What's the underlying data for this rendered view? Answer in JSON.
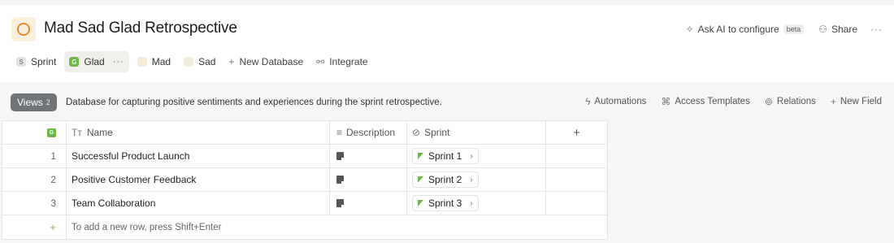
{
  "header": {
    "title": "Mad Sad Glad Retrospective",
    "ask_ai_label": "Ask AI to configure",
    "beta_label": "beta",
    "share_label": "Share",
    "more_label": "···"
  },
  "tabs": [
    {
      "label": "Sprint",
      "badge": "S"
    },
    {
      "label": "Glad",
      "badge": "G",
      "more": "···"
    },
    {
      "label": "Mad",
      "badge": ""
    },
    {
      "label": "Sad",
      "badge": ""
    },
    {
      "label": "New Database",
      "icon": "+"
    },
    {
      "label": "Integrate",
      "icon": "link-icon"
    }
  ],
  "toolbar": {
    "views_label": "Views",
    "views_count": "2",
    "description": "Database for capturing positive sentiments and experiences during the sprint retrospective.",
    "automations_label": "Automations",
    "access_templates_label": "Access Templates",
    "relations_label": "Relations",
    "new_field_label": "New Field"
  },
  "table": {
    "index_badge": "G",
    "columns": {
      "name": "Name",
      "description": "Description",
      "sprint": "Sprint",
      "add": "+"
    },
    "rows": [
      {
        "index": "1",
        "name": "Successful Product Launch",
        "sprint": "Sprint 1"
      },
      {
        "index": "2",
        "name": "Positive Customer Feedback",
        "sprint": "Sprint 2"
      },
      {
        "index": "3",
        "name": "Team Collaboration",
        "sprint": "Sprint 3"
      }
    ],
    "new_row_icon": "+",
    "new_row_hint": "To add a new row, press Shift+Enter"
  },
  "colors": {
    "accent_green": "#6cb64a",
    "app_icon_orange": "#e8892b",
    "views_button": "#6f7478"
  }
}
